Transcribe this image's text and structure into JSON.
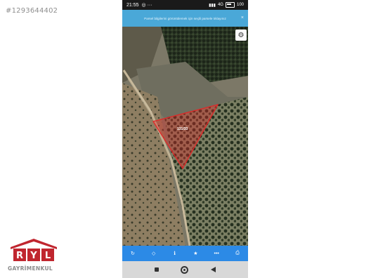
{
  "listing_id": "#1293644402",
  "status_bar": {
    "time": "21:55",
    "network": "4G",
    "battery": "100"
  },
  "banner": {
    "text": "Parsel bilgilerini görüntülemek için seçili parsele tıklayınız",
    "close": "×"
  },
  "map": {
    "parcel_label": "131/33",
    "parcel_color": "#e02828"
  },
  "toolbar": {
    "icons": [
      "refresh-icon",
      "locate-icon",
      "info-icon",
      "star-icon",
      "more-icon",
      "print-icon"
    ]
  },
  "logo": {
    "letters": "RYL",
    "text": "GAYRİMENKUL",
    "color": "#c0262f"
  }
}
